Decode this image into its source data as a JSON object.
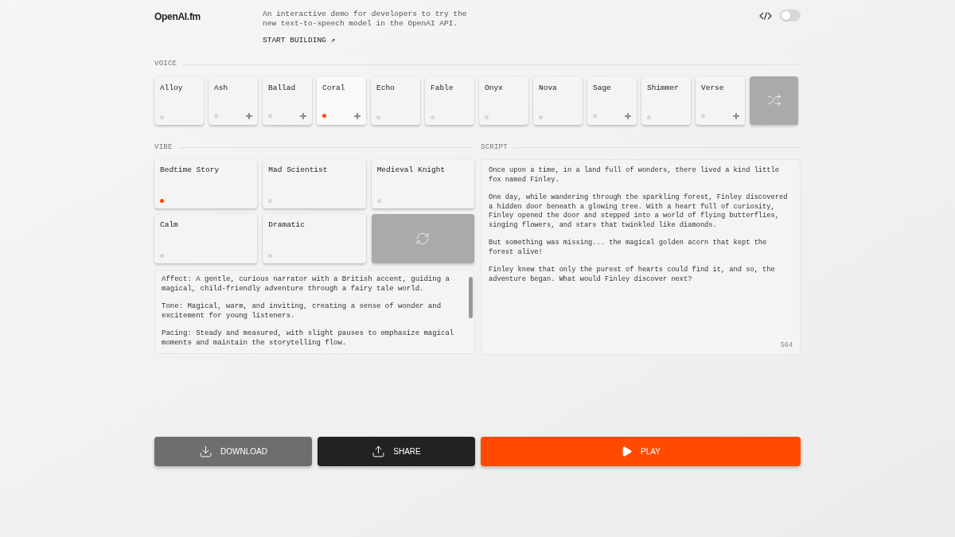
{
  "header": {
    "logo": "OpenAI.fm",
    "description": "An interactive demo for developers to try the new text-to-speech model in the OpenAI API.",
    "link": "START BUILDING ↗",
    "code_toggle": {
      "on": false
    }
  },
  "voice": {
    "label": "VOICE",
    "items": [
      {
        "name": "Alloy",
        "selected": false,
        "sparkle": false
      },
      {
        "name": "Ash",
        "selected": false,
        "sparkle": true
      },
      {
        "name": "Ballad",
        "selected": false,
        "sparkle": true
      },
      {
        "name": "Coral",
        "selected": true,
        "sparkle": true
      },
      {
        "name": "Echo",
        "selected": false,
        "sparkle": false
      },
      {
        "name": "Fable",
        "selected": false,
        "sparkle": false
      },
      {
        "name": "Onyx",
        "selected": false,
        "sparkle": false
      },
      {
        "name": "Nova",
        "selected": false,
        "sparkle": false
      },
      {
        "name": "Sage",
        "selected": false,
        "sparkle": true
      },
      {
        "name": "Shimmer",
        "selected": false,
        "sparkle": false
      },
      {
        "name": "Verse",
        "selected": false,
        "sparkle": true
      }
    ]
  },
  "vibe": {
    "label": "VIBE",
    "items": [
      {
        "name": "Bedtime Story",
        "selected": true
      },
      {
        "name": "Mad Scientist",
        "selected": false
      },
      {
        "name": "Medieval Knight",
        "selected": false
      },
      {
        "name": "Calm",
        "selected": false
      },
      {
        "name": "Dramatic",
        "selected": false
      }
    ],
    "instructions": [
      "Affect: A gentle, curious narrator with a British accent, guiding a magical, child-friendly adventure through a fairy tale world.",
      "Tone: Magical, warm, and inviting, creating a sense of wonder and excitement for young listeners.",
      "Pacing: Steady and measured, with slight pauses to emphasize magical moments and maintain the storytelling flow."
    ]
  },
  "script": {
    "label": "SCRIPT",
    "paragraphs": [
      "Once upon a time, in a land full of wonders, there lived a kind little fox named Finley.",
      "One day, while wandering through the sparkling forest, Finley discovered a hidden door beneath a glowing tree. With a heart full of curiosity, Finley opened the door and stepped into a world of flying butterflies, singing flowers, and stars that twinkled like diamonds.",
      "But something was missing... the magical golden acorn that kept the forest alive!",
      "Finley knew that only the purest of hearts could find it, and so, the adventure began. What would Finley discover next?"
    ],
    "count": "564"
  },
  "actions": [
    {
      "kind": "download",
      "label": "DOWNLOAD"
    },
    {
      "kind": "share",
      "label": "SHARE"
    },
    {
      "kind": "play",
      "label": "PLAY"
    }
  ]
}
